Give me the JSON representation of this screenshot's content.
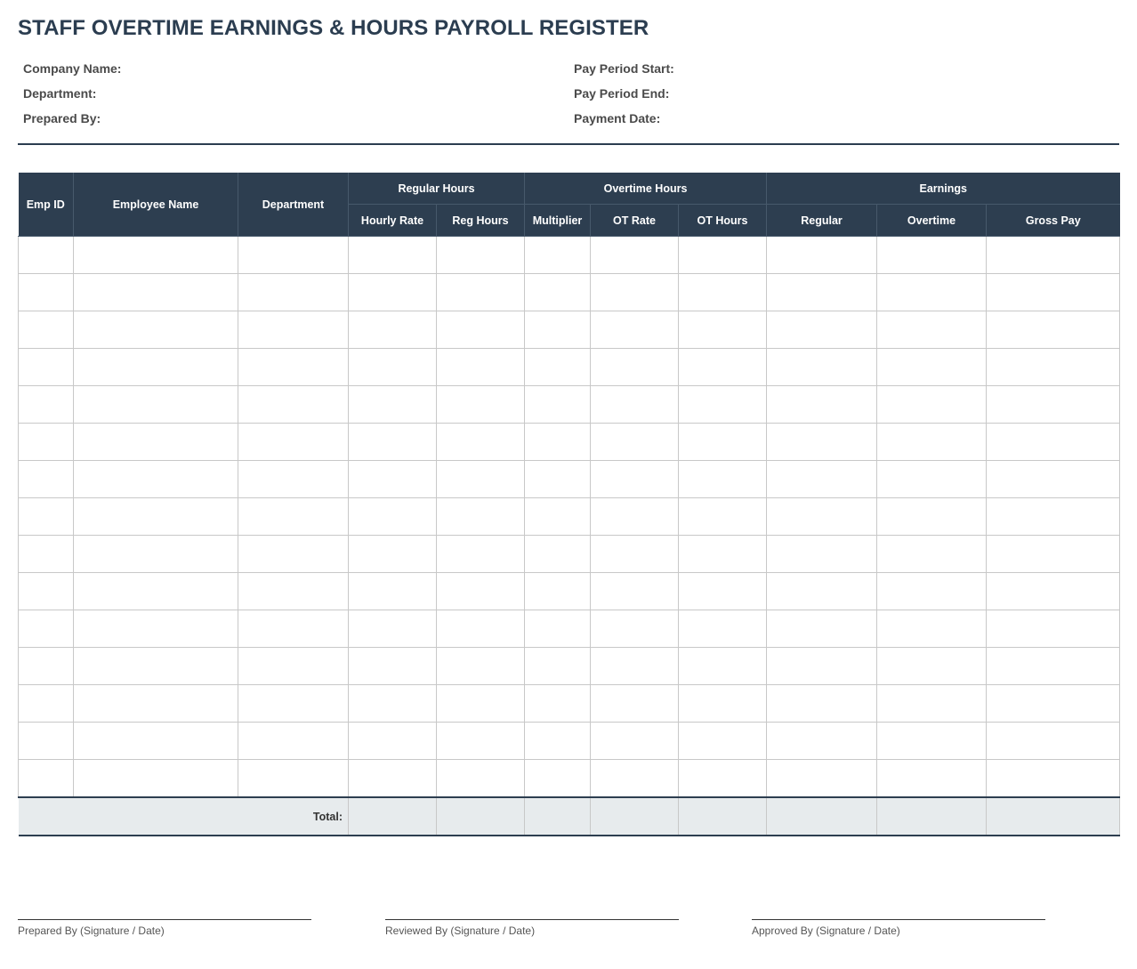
{
  "title": "STAFF OVERTIME EARNINGS & HOURS PAYROLL REGISTER",
  "info": {
    "company_name": "Company Name:",
    "department": "Department:",
    "prepared_by": "Prepared By:",
    "pay_period_start": "Pay Period Start:",
    "pay_period_end": "Pay Period End:",
    "payment_date": "Payment Date:"
  },
  "table": {
    "header_groups": {
      "emp_id": "Emp ID",
      "employee_name": "Employee Name",
      "department": "Department",
      "regular_hours": "Regular Hours",
      "overtime_hours": "Overtime Hours",
      "earnings": "Earnings"
    },
    "sub_headers": {
      "hourly_rate": "Hourly Rate",
      "reg_hours": "Reg Hours",
      "multiplier": "Multiplier",
      "ot_rate": "OT Rate",
      "ot_hours": "OT Hours",
      "regular": "Regular",
      "overtime": "Overtime",
      "gross_pay": "Gross Pay"
    },
    "empty_row_count": 15,
    "total_label": "Total:"
  },
  "signatures": {
    "prepared": "Prepared By (Signature / Date)",
    "reviewed": "Reviewed By (Signature / Date)",
    "approved": "Approved By (Signature / Date)"
  },
  "colors": {
    "header_bg": "#2d3e50",
    "title_color": "#2b3d50",
    "total_row_bg": "#e7ebed"
  }
}
